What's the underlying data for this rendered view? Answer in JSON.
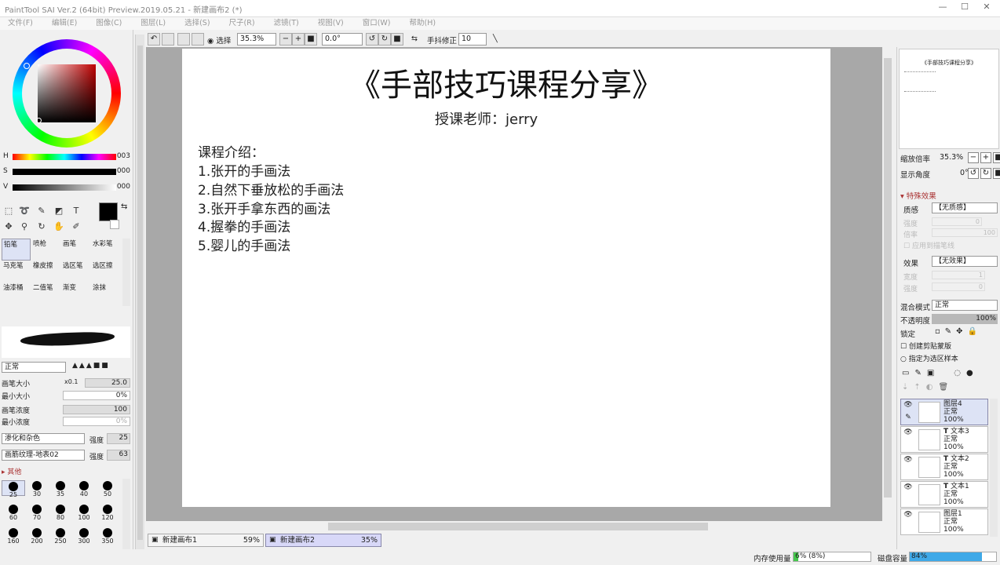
{
  "window": {
    "title": "PaintTool SAI Ver.2 (64bit) Preview.2019.05.21 - 新建画布2 (*)"
  },
  "menu": [
    "文件(F)",
    "编辑(E)",
    "图像(C)",
    "图层(L)",
    "选择(S)",
    "尺子(R)",
    "滤镜(T)",
    "视图(V)",
    "窗口(W)",
    "帮助(H)"
  ],
  "color_sliders": [
    {
      "label": "H",
      "value": "003"
    },
    {
      "label": "S",
      "value": "000"
    },
    {
      "label": "V",
      "value": "000"
    }
  ],
  "brushes": [
    "铅笔",
    "喷枪",
    "画笔",
    "水彩笔",
    "马克笔",
    "橡皮擦",
    "选区笔",
    "选区擦",
    "油漆桶",
    "二值笔",
    "渐变",
    "涂抹"
  ],
  "brush_props": {
    "blend": "正常",
    "size_label": "画笔大小",
    "size_mult": "x0.1",
    "size_val": "25.0",
    "min_size_label": "最小大小",
    "min_size_val": "0%",
    "density_label": "画笔浓度",
    "density_val": "100",
    "min_density_label": "最小浓度",
    "min_density_val": "0%",
    "blur_mode": "渗化和杂色",
    "blur_label": "强度",
    "blur_val": "25",
    "texture": "画筋纹理-地表02",
    "texture_label": "强度",
    "texture_val": "63",
    "other_label": "其他"
  },
  "brush_sizes": [
    "25",
    "30",
    "35",
    "40",
    "50",
    "60",
    "70",
    "80",
    "100",
    "120",
    "160",
    "200",
    "250",
    "300",
    "350"
  ],
  "toolbar": {
    "select_label": "选择",
    "zoom": "35.3%",
    "angle": "0.0°",
    "stab_label": "手抖修正",
    "stab_val": "10"
  },
  "document": {
    "title": "《手部技巧课程分享》",
    "teacher": "授课老师：jerry",
    "lines": [
      "课程介绍：",
      "1.张开的手画法",
      "2.自然下垂放松的手画法",
      "3.张开手拿东西的画法",
      "4.握拳的手画法",
      "5.婴儿的手画法"
    ]
  },
  "tabs": [
    {
      "name": "新建画布1",
      "zoom": "59%"
    },
    {
      "name": "新建画布2",
      "zoom": "35%"
    }
  ],
  "status": {
    "mem_label": "内存使用量",
    "mem_val": "6% (8%)",
    "mem_pct": 0.06,
    "disk_label": "磁盘容量",
    "disk_val": "84%",
    "disk_pct": 0.84
  },
  "navigator": {
    "zoom_label": "缩放倍率",
    "zoom_val": "35.3%",
    "angle_label": "显示角度",
    "angle_val": "0°",
    "mini_title": "《手部技巧课程分享》"
  },
  "effects": {
    "header": "特殊效果",
    "texture_label": "质感",
    "texture_val": "【无质感】",
    "strength_label": "强度",
    "strength_val": "0",
    "scale_label": "倍率",
    "scale_val": "100",
    "apply_label": "应用到描笔线",
    "effect_label": "效果",
    "effect_val": "【无效果】",
    "width_label": "宽度",
    "width_val": "1",
    "str2_label": "强度",
    "str2_val": "0"
  },
  "layer_props": {
    "blend_label": "混合模式",
    "blend_val": "正常",
    "opacity_label": "不透明度",
    "opacity_val": "100%",
    "lock_label": "锁定",
    "clip_label": "创建剪贴蒙版",
    "sample_label": "指定为选区样本"
  },
  "layers": [
    {
      "name": "图层4",
      "mode": "正常",
      "opacity": "100%",
      "type": "raster"
    },
    {
      "name": "文本3",
      "mode": "正常",
      "opacity": "100%",
      "type": "text"
    },
    {
      "name": "文本2",
      "mode": "正常",
      "opacity": "100%",
      "type": "text"
    },
    {
      "name": "文本1",
      "mode": "正常",
      "opacity": "100%",
      "type": "text"
    },
    {
      "name": "图层1",
      "mode": "正常",
      "opacity": "100%",
      "type": "raster"
    }
  ]
}
